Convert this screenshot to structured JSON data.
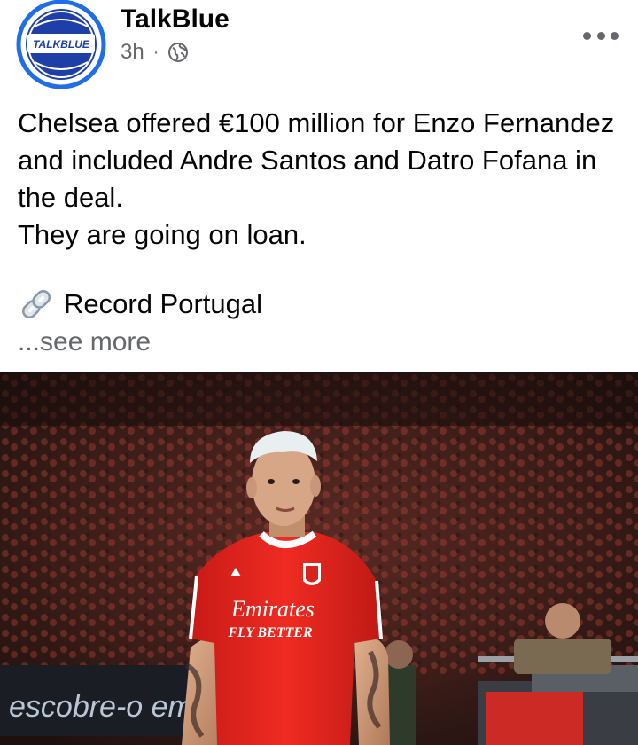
{
  "post": {
    "author": "TalkBlue",
    "avatar_text": "TALKBLUE",
    "time": "3h",
    "separator": "·",
    "audience_icon": "globe-icon",
    "text_lines": [
      "Chelsea offered €100 million for Enzo Fernandez and included Andre Santos and Datro Fofana in the deal.",
      "They are going on loan."
    ],
    "source_icon": "link-icon",
    "source": "Record Portugal",
    "see_more": "...see more",
    "photo": {
      "jersey_sponsor_line1": "Emirates",
      "jersey_sponsor_line2": "FLY BETTER",
      "board_text": "escobre-o em"
    }
  },
  "colors": {
    "brand_blue": "#1f5fd6",
    "text": "#050505",
    "secondary_text": "#65676b",
    "jersey_red": "#e3241d"
  }
}
